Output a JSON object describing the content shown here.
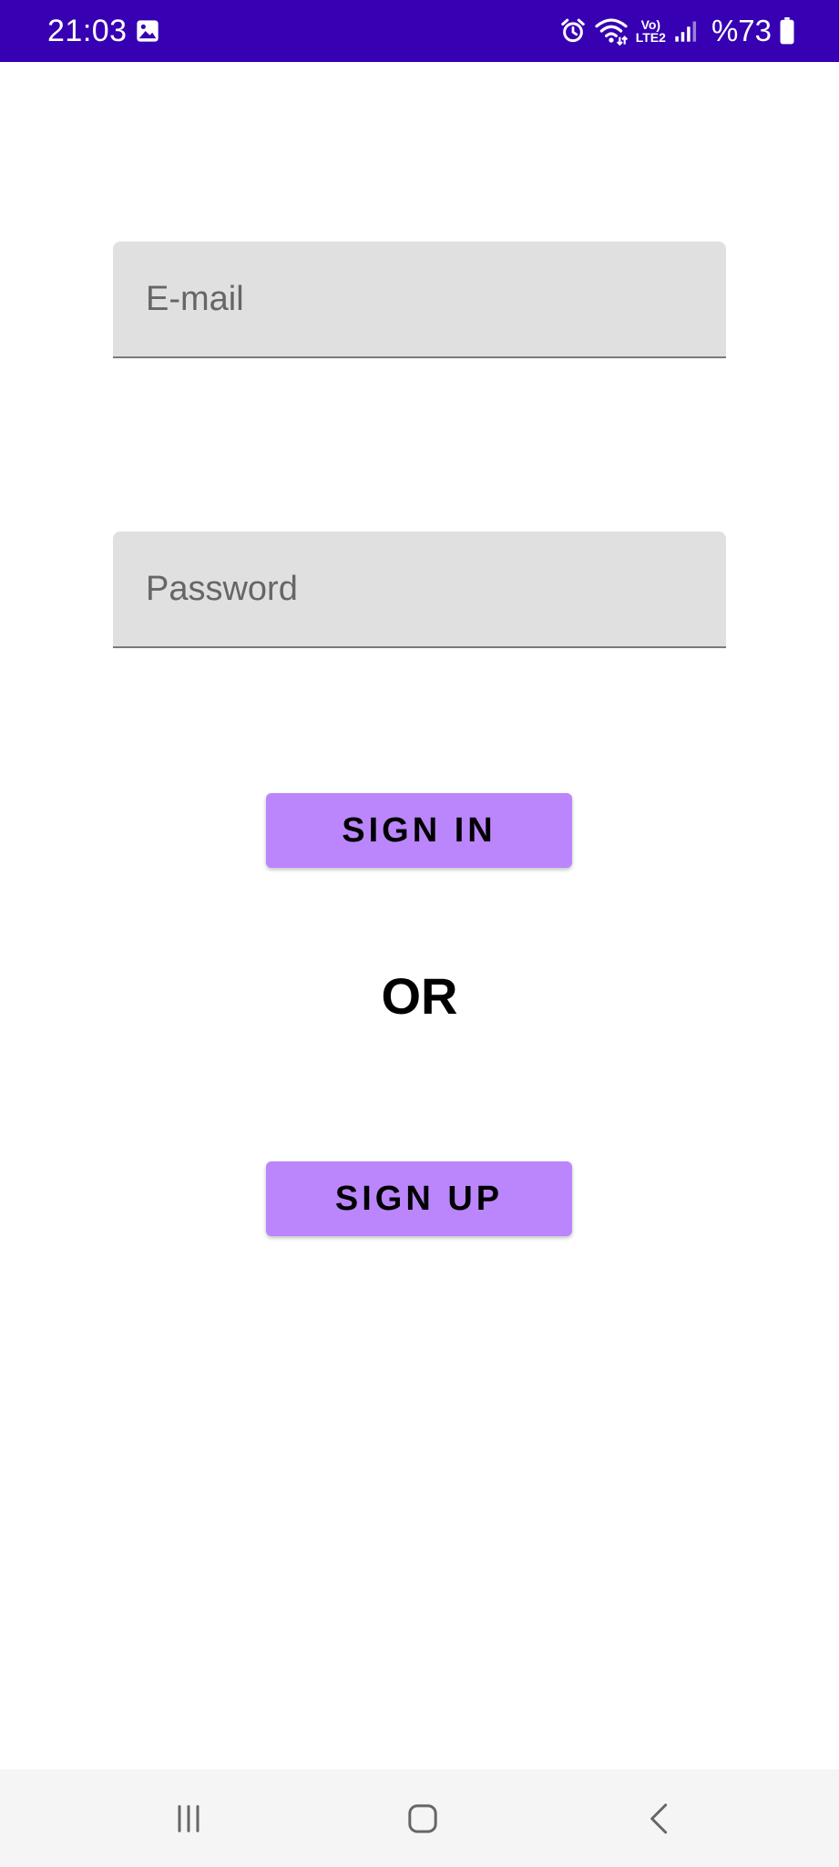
{
  "status_bar": {
    "time": "21:03",
    "battery": "%73",
    "network_label_top": "Vo)",
    "network_label_bottom": "LTE2",
    "icons": [
      "gallery-icon",
      "alarm-icon",
      "wifi-icon",
      "signal-icon",
      "battery-icon"
    ],
    "background_color": "#3700B3"
  },
  "form": {
    "email_placeholder": "E-mail",
    "password_placeholder": "Password"
  },
  "buttons": {
    "sign_in_label": "SIGN IN",
    "or_label": "OR",
    "sign_up_label": "SIGN UP",
    "accent_color": "#BB86FC"
  },
  "nav_bar": {
    "icons": [
      "recents-icon",
      "home-icon",
      "back-icon"
    ]
  }
}
